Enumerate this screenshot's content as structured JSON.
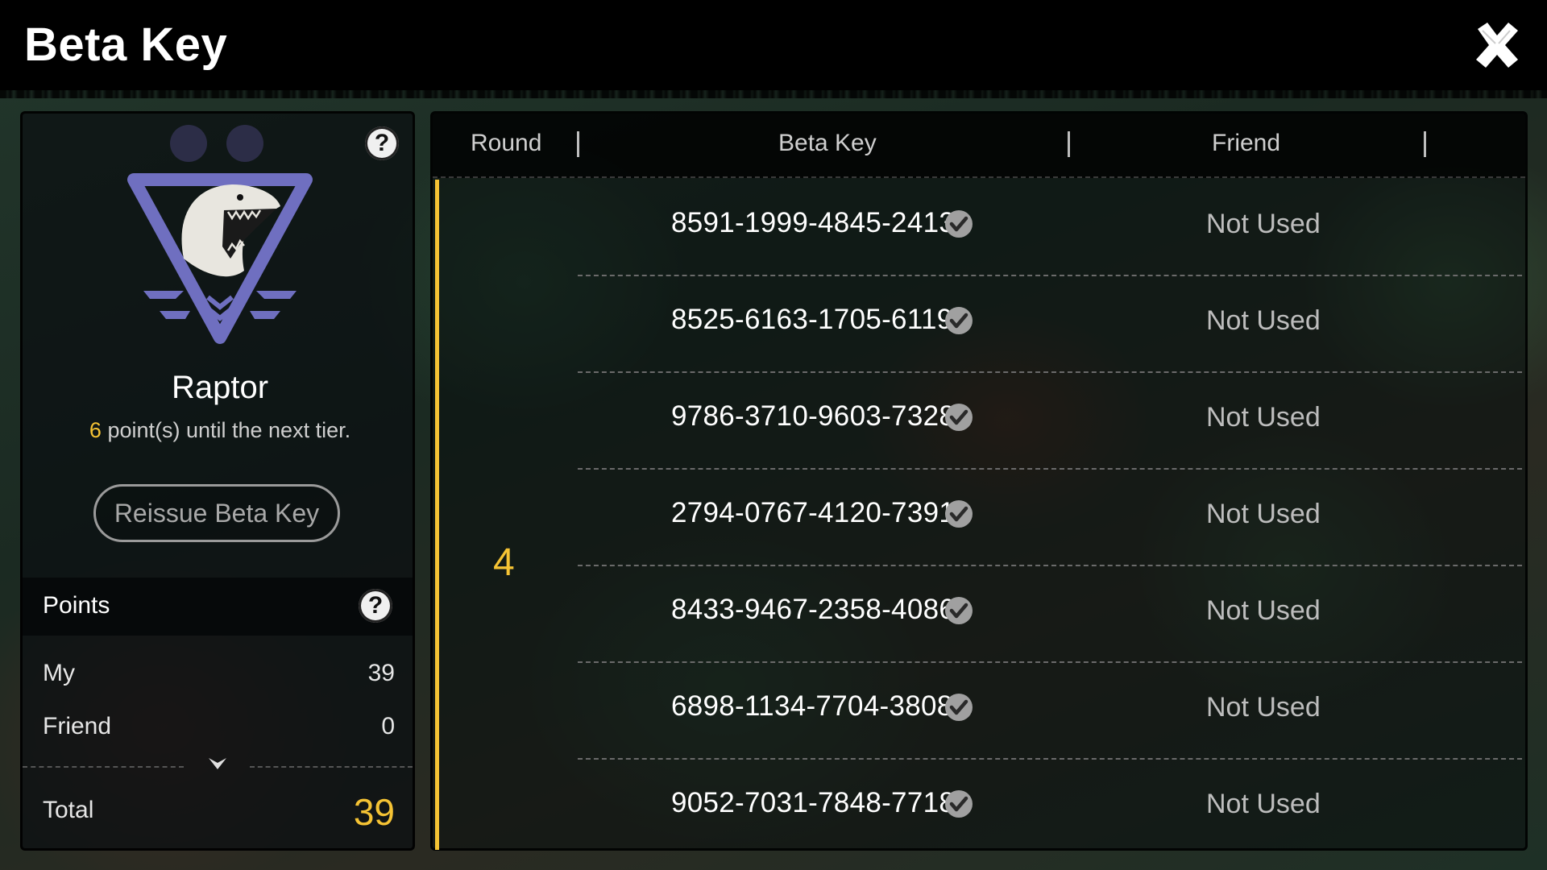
{
  "header": {
    "title": "Beta Key"
  },
  "tier": {
    "name": "Raptor",
    "points_to_next": "6",
    "note_suffix": " point(s) until the next tier."
  },
  "reissue_label": "Reissue Beta Key",
  "points": {
    "title": "Points",
    "rows": [
      {
        "label": "My",
        "value": "39"
      },
      {
        "label": "Friend",
        "value": "0"
      }
    ],
    "total_label": "Total",
    "total_value": "39"
  },
  "table": {
    "headers": {
      "round": "Round",
      "beta_key": "Beta Key",
      "friend": "Friend"
    },
    "round": "4",
    "rows": [
      {
        "key": "8591-1999-4845-2413",
        "status": "Not Used"
      },
      {
        "key": "8525-6163-1705-6119",
        "status": "Not Used"
      },
      {
        "key": "9786-3710-9603-7328",
        "status": "Not Used"
      },
      {
        "key": "2794-0767-4120-7391",
        "status": "Not Used"
      },
      {
        "key": "8433-9467-2358-4086",
        "status": "Not Used"
      },
      {
        "key": "6898-1134-7704-3808",
        "status": "Not Used"
      },
      {
        "key": "9052-7031-7848-7718",
        "status": "Not Used"
      }
    ]
  },
  "colors": {
    "accent": "#f5c334",
    "emblem": "#6f6fc0"
  }
}
